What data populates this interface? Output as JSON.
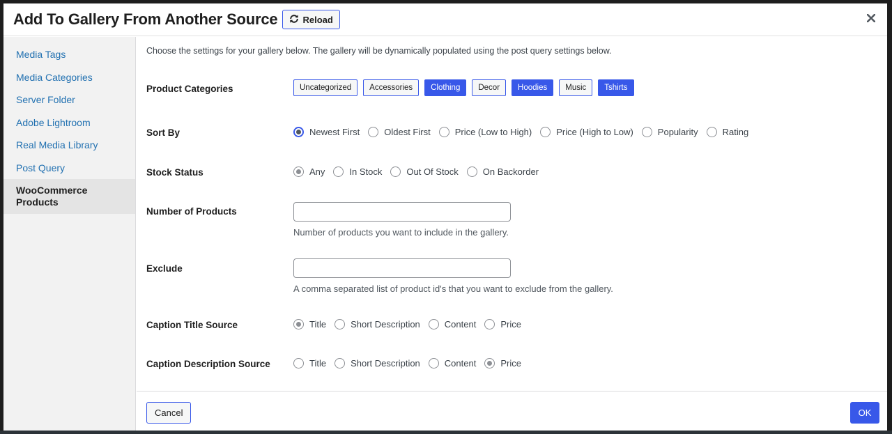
{
  "dialog": {
    "title": "Add To Gallery From Another Source",
    "reload_label": "Reload",
    "close_icon": "close-icon",
    "reload_icon": "refresh-icon"
  },
  "sidebar": {
    "items": [
      {
        "label": "Media Tags",
        "active": false
      },
      {
        "label": "Media Categories",
        "active": false
      },
      {
        "label": "Server Folder",
        "active": false
      },
      {
        "label": "Adobe Lightroom",
        "active": false
      },
      {
        "label": "Real Media Library",
        "active": false
      },
      {
        "label": "Post Query",
        "active": false
      },
      {
        "label": "WooCommerce Products",
        "active": true
      }
    ]
  },
  "main": {
    "intro": "Choose the settings for your gallery below. The gallery will be dynamically populated using the post query settings below.",
    "product_categories": {
      "label": "Product Categories",
      "options": [
        {
          "label": "Uncategorized",
          "selected": false
        },
        {
          "label": "Accessories",
          "selected": false
        },
        {
          "label": "Clothing",
          "selected": true
        },
        {
          "label": "Decor",
          "selected": false
        },
        {
          "label": "Hoodies",
          "selected": true
        },
        {
          "label": "Music",
          "selected": false
        },
        {
          "label": "Tshirts",
          "selected": true
        }
      ]
    },
    "sort_by": {
      "label": "Sort By",
      "options": [
        "Newest First",
        "Oldest First",
        "Price (Low to High)",
        "Price (High to Low)",
        "Popularity",
        "Rating"
      ],
      "selected": "Newest First"
    },
    "stock_status": {
      "label": "Stock Status",
      "options": [
        "Any",
        "In Stock",
        "Out Of Stock",
        "On Backorder"
      ],
      "selected": "Any"
    },
    "number_of_products": {
      "label": "Number of Products",
      "value": "",
      "placeholder": "",
      "help": "Number of products you want to include in the gallery."
    },
    "exclude": {
      "label": "Exclude",
      "value": "",
      "placeholder": "",
      "help": "A comma separated list of product id's that you want to exclude from the gallery."
    },
    "caption_title_source": {
      "label": "Caption Title Source",
      "options": [
        "Title",
        "Short Description",
        "Content",
        "Price"
      ],
      "selected": "Title"
    },
    "caption_description_source": {
      "label": "Caption Description Source",
      "options": [
        "Title",
        "Short Description",
        "Content",
        "Price"
      ],
      "selected": "Price"
    }
  },
  "footer": {
    "cancel_label": "Cancel",
    "ok_label": "OK"
  },
  "colors": {
    "accent": "#3858e9",
    "link": "#2271b1"
  }
}
